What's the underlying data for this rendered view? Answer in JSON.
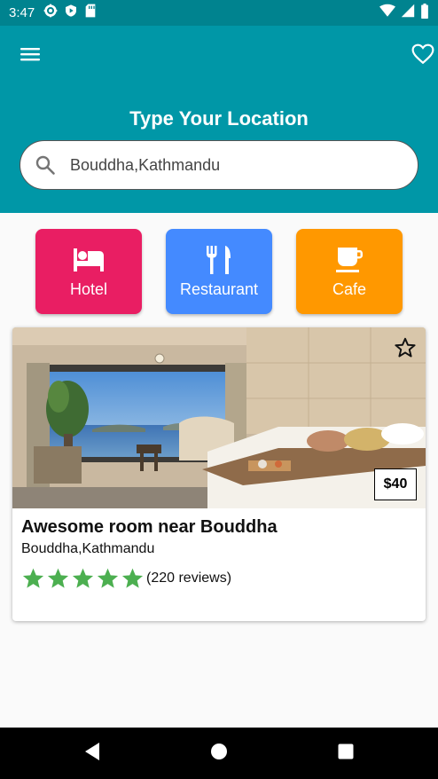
{
  "status_bar": {
    "time": "3:47",
    "icons": [
      "settings-icon",
      "shield-play-icon",
      "sd-card-icon",
      "wifi-icon",
      "signal-icon",
      "battery-icon"
    ]
  },
  "app_bar": {
    "menu_icon": "menu-icon",
    "favorite_icon": "heart-outline-icon",
    "title": "Type Your Location",
    "search": {
      "value": "Bouddha,Kathmandu",
      "icon": "search-icon"
    },
    "color": "#0097a7"
  },
  "categories": [
    {
      "label": "Hotel",
      "icon": "bed-icon",
      "color": "#e91e63"
    },
    {
      "label": "Restaurant",
      "icon": "fork-knife-icon",
      "color": "#448aff"
    },
    {
      "label": "Cafe",
      "icon": "coffee-cup-icon",
      "color": "#ff9800"
    }
  ],
  "listing": {
    "title": "Awesome room near Bouddha",
    "location": "Bouddha,Kathmandu",
    "price": "$40",
    "rating": 5,
    "reviews": "(220 reviews)",
    "star_color": "#4caf50",
    "favorite_icon": "star-outline-icon"
  },
  "nav_bar": {
    "buttons": [
      "back-triangle-icon",
      "home-circle-icon",
      "recents-square-icon"
    ]
  }
}
